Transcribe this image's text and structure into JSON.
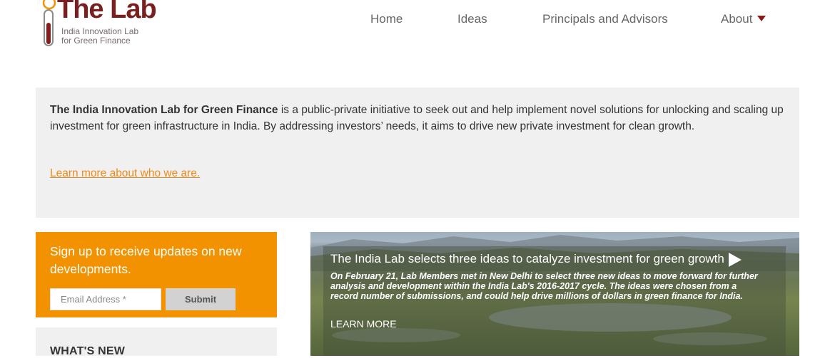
{
  "logo": {
    "title": "The Lab",
    "subtitle_line1": "India Innovation Lab",
    "subtitle_line2": "for Green Finance"
  },
  "nav": {
    "home": "Home",
    "ideas": "Ideas",
    "principals": "Principals and Advisors",
    "about": "About"
  },
  "intro": {
    "bold_lead": "The India Innovation Lab for Green Finance",
    "text": " is a public-private initiative to seek out and help implement novel solutions for unlocking and scaling up investment for green infrastructure in India. By addressing investors’ needs, it aims to drive new private investment for clean growth.",
    "link": "Learn more about who we are."
  },
  "signup": {
    "heading": "Sign up to receive updates on new developments.",
    "email_placeholder": "Email Address *",
    "submit_label": "Submit"
  },
  "whats_new": {
    "title": "WHAT'S NEW"
  },
  "hero": {
    "title": "The India Lab selects three ideas to catalyze investment for green growth",
    "body": "On February 21, Lab Members met in New Delhi to select three new ideas to move forward for further analysis and development within the India Lab's 2016-2017 cycle. The ideas were chosen from a record number of submissions, and could help drive millions of dollars in green finance for India.",
    "more": "LEARN MORE"
  },
  "colors": {
    "brand": "#7a1f1f",
    "accent_orange": "#f39200",
    "link_orange": "#ee8a1c",
    "panel_gray": "#f0f0f0"
  }
}
